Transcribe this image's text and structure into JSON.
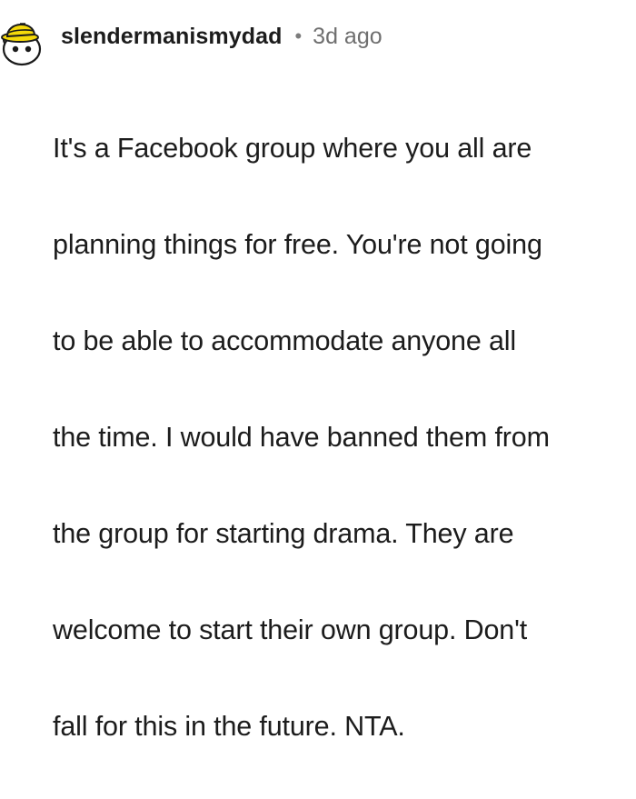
{
  "comment": {
    "author": "slendermanismydad",
    "separator": "•",
    "timestamp": "3d ago",
    "avatar_icon": "snoo-avatar-yellow-hat-icon",
    "body_lines": [
      "It's a Facebook group where you all are",
      "planning things for free. You're not going",
      "to be able to accommodate anyone all",
      "the time. I would have banned them from",
      "the group for starting drama. They are",
      "welcome to start their own group. Don't",
      "fall for this in the future. NTA."
    ]
  },
  "colors": {
    "text": "#1c1c1c",
    "meta": "#6f6f6f",
    "avatar_hat": "#f5d90a",
    "avatar_face": "#ffffff",
    "avatar_outline": "#1a1a1a"
  }
}
